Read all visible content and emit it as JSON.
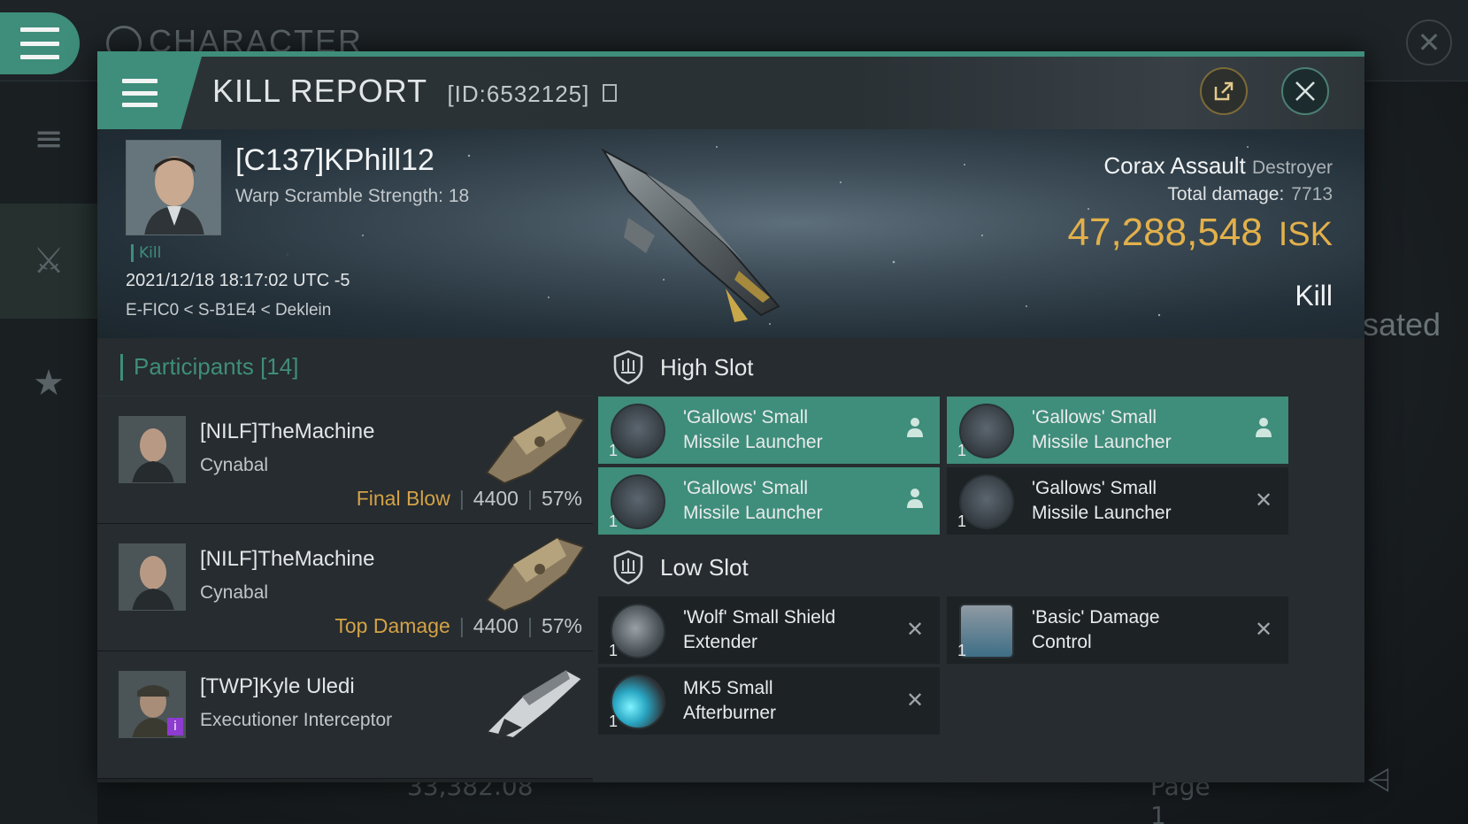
{
  "background": {
    "title": "CHARACTER",
    "right_text": "sated",
    "bottom_value": "33,382.08",
    "bottom_page": "Page 1"
  },
  "dialog": {
    "title": "KILL REPORT",
    "id": "[ID:6532125]"
  },
  "victim": {
    "name": "[C137]KPhill12",
    "subtitle": "Warp Scramble Strength: 18",
    "tag": "Kill",
    "datetime": "2021/12/18 18:17:02 UTC -5",
    "location": "E-FIC0 < S-B1E4 < Deklein",
    "ship_name": "Corax Assault",
    "ship_class": "Destroyer",
    "damage_label": "Total damage:",
    "damage_value": "7713",
    "isk_value": "47,288,548",
    "isk_unit": "ISK",
    "result": "Kill"
  },
  "participants": {
    "label": "Participants",
    "count": "[14]",
    "items": [
      {
        "name": "[NILF]TheMachine",
        "ship": "Cynabal",
        "tag": "Final Blow",
        "damage": "4400",
        "percent": "57%"
      },
      {
        "name": "[NILF]TheMachine",
        "ship": "Cynabal",
        "tag": "Top Damage",
        "damage": "4400",
        "percent": "57%"
      },
      {
        "name": "[TWP]Kyle Uledi",
        "ship": "Executioner Interceptor",
        "tag": "",
        "damage": "",
        "percent": ""
      }
    ]
  },
  "fittings": {
    "high_slot_label": "High Slot",
    "low_slot_label": "Low Slot",
    "high": [
      {
        "line1": "'Gallows' Small",
        "line2": "Missile Launcher",
        "qty": "1",
        "status": "person",
        "active": true
      },
      {
        "line1": "'Gallows' Small",
        "line2": "Missile Launcher",
        "qty": "1",
        "status": "person",
        "active": true
      },
      {
        "line1": "'Gallows' Small",
        "line2": "Missile Launcher",
        "qty": "1",
        "status": "person",
        "active": true
      },
      {
        "line1": "'Gallows' Small",
        "line2": "Missile Launcher",
        "qty": "1",
        "status": "x",
        "active": false
      }
    ],
    "low": [
      {
        "line1": "'Wolf' Small Shield",
        "line2": "Extender",
        "qty": "1",
        "status": "x",
        "active": false
      },
      {
        "line1": "'Basic' Damage",
        "line2": "Control",
        "qty": "1",
        "status": "x",
        "active": false
      },
      {
        "line1": "MK5 Small",
        "line2": "Afterburner",
        "qty": "1",
        "status": "x",
        "active": false
      }
    ]
  },
  "colors": {
    "accent": "#3f8d7b",
    "isk": "#e2b04a",
    "final_blow": "#d4a247"
  }
}
